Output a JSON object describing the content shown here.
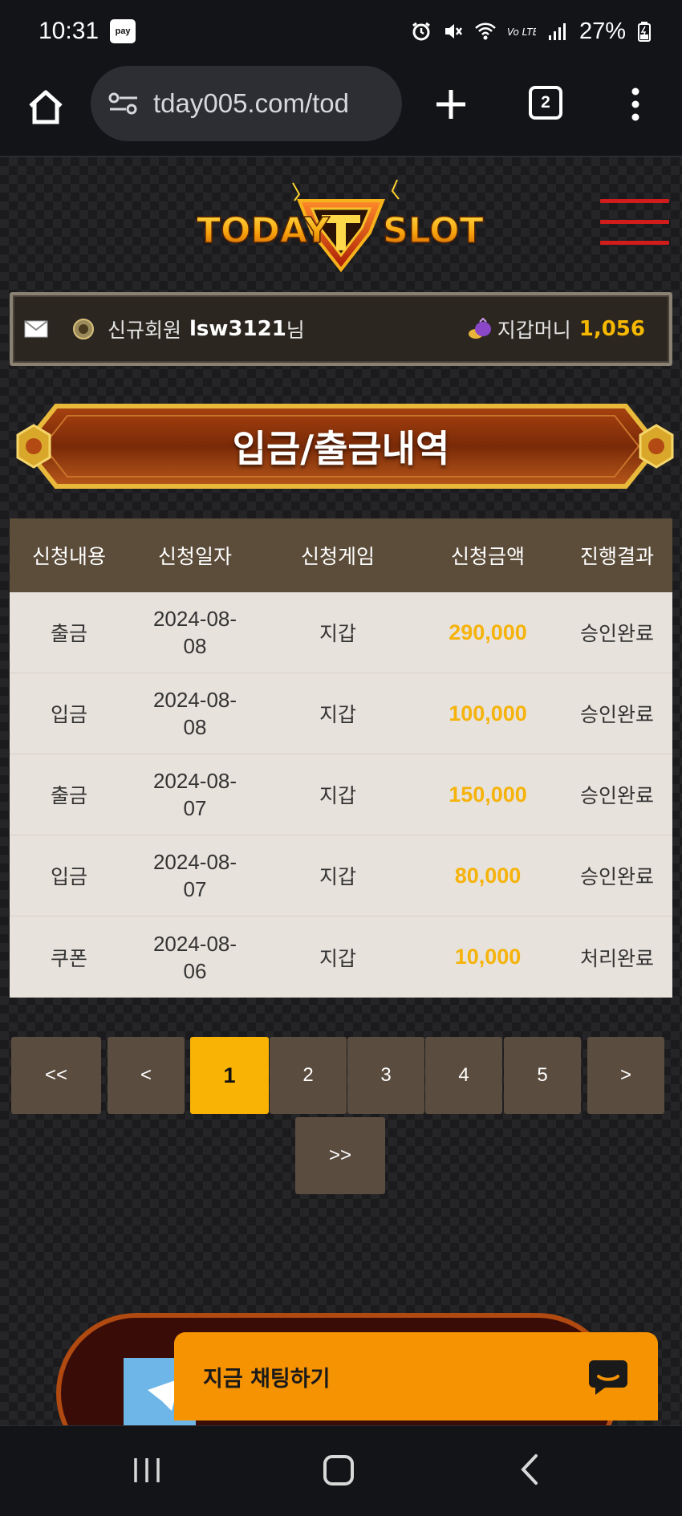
{
  "status_bar": {
    "time": "10:31",
    "pay_badge": "pay",
    "battery": "27%",
    "lte": "Vo LTE"
  },
  "browser": {
    "url": "tday005.com/tod",
    "tab_count": "2"
  },
  "site": {
    "logo_left": "TODAY",
    "logo_right": "SLOT",
    "user_label": "신규회원",
    "username": "lsw3121",
    "username_suffix": "님",
    "wallet_label": "지갑머니",
    "wallet_amount": "1,056",
    "page_title": "입금/출금내역"
  },
  "table": {
    "headers": [
      "신청내용",
      "신청일자",
      "신청게임",
      "신청금액",
      "진행결과"
    ],
    "rows": [
      {
        "type": "출금",
        "date_line1": "2024-08-",
        "date_line2": "08",
        "game": "지갑",
        "amount": "290,000",
        "result": "승인완료"
      },
      {
        "type": "입금",
        "date_line1": "2024-08-",
        "date_line2": "08",
        "game": "지갑",
        "amount": "100,000",
        "result": "승인완료"
      },
      {
        "type": "출금",
        "date_line1": "2024-08-",
        "date_line2": "07",
        "game": "지갑",
        "amount": "150,000",
        "result": "승인완료"
      },
      {
        "type": "입금",
        "date_line1": "2024-08-",
        "date_line2": "07",
        "game": "지갑",
        "amount": "80,000",
        "result": "승인완료"
      },
      {
        "type": "쿠폰",
        "date_line1": "2024-08-",
        "date_line2": "06",
        "game": "지갑",
        "amount": "10,000",
        "result": "처리완료"
      }
    ]
  },
  "pagination": {
    "first": "<<",
    "prev": "<",
    "pages": [
      "1",
      "2",
      "3",
      "4",
      "5"
    ],
    "next": ">",
    "last": ">>",
    "current": "1"
  },
  "chat": {
    "label": "지금 채팅하기"
  },
  "colors": {
    "accent_gold": "#f8b305",
    "amount_gold": "#f5b30c",
    "menu_red": "#d11c1c",
    "table_header": "#5c4c3a",
    "chat_orange": "#f59303"
  }
}
